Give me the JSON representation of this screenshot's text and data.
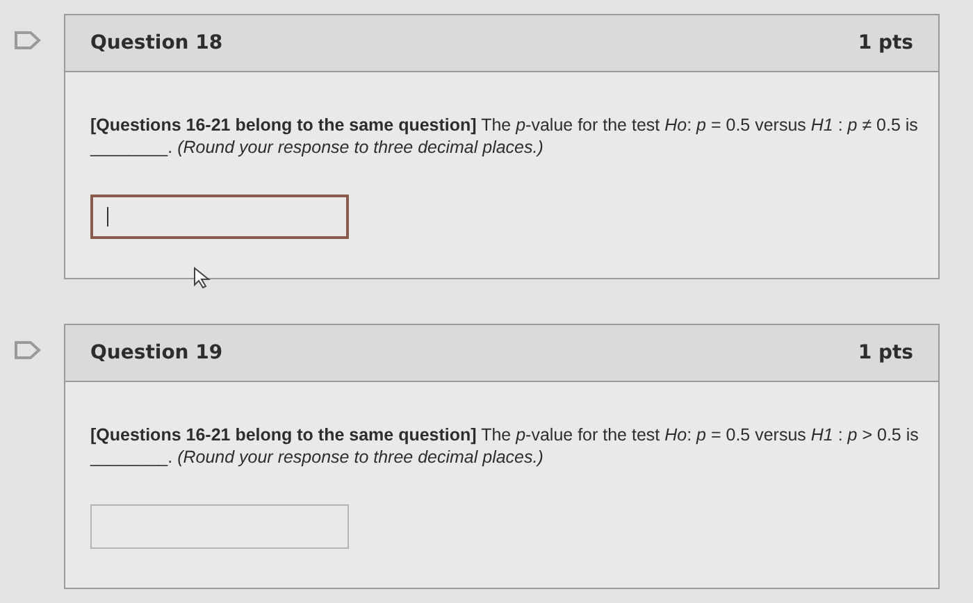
{
  "questions": [
    {
      "title": "Question 18",
      "points": "1 pts",
      "text": "**[Questions 16-21 belong to the same question]**  The *p*-value for the test *Ho*: *p* = 0.5 versus *H1* : *p* ≠ 0.5 is ________. *(Round your response to three decimal places.)*",
      "answer": {
        "focused": true
      }
    },
    {
      "title": "Question 19",
      "points": "1 pts",
      "text": "**[Questions 16-21 belong to the same question]**  The *p*-value for the test *Ho*: *p* = 0.5 versus *H1* : *p* > 0.5 is ________. *(Round your response to three decimal places.)*",
      "answer": {
        "focused": false
      }
    }
  ]
}
